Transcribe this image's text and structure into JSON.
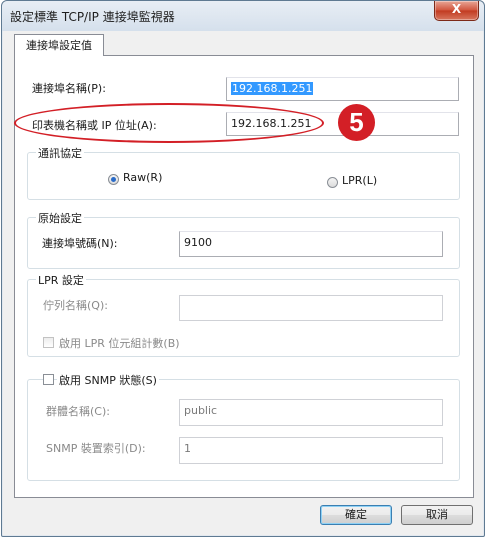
{
  "window": {
    "title": "設定標準 TCP/IP 連接埠監視器",
    "close_label": "X"
  },
  "tab": {
    "label": "連接埠設定值"
  },
  "port_name": {
    "label": "連接埠名稱(P):",
    "value": "192.168.1.251"
  },
  "printer_address": {
    "label": "印表機名稱或 IP 位址(A):",
    "value": "192.168.1.251"
  },
  "annotation": {
    "step": "5",
    "color": "#d31f26"
  },
  "protocol": {
    "title": "通訊協定",
    "raw_label": "Raw(R)",
    "lpr_label": "LPR(L)",
    "selected": "Raw(R)"
  },
  "raw_settings": {
    "title": "原始設定",
    "port_number_label": "連接埠號碼(N):",
    "port_number_value": "9100"
  },
  "lpr_settings": {
    "title": "LPR 設定",
    "queue_name_label": "佇列名稱(Q):",
    "queue_name_value": "",
    "byte_counting_label": "啟用 LPR 位元組計數(B)"
  },
  "snmp": {
    "enable_label": "啟用 SNMP 狀態(S)",
    "community_label": "群體名稱(C):",
    "community_value": "public",
    "device_index_label": "SNMP 裝置索引(D):",
    "device_index_value": "1"
  },
  "buttons": {
    "ok": "確定",
    "cancel": "取消"
  }
}
